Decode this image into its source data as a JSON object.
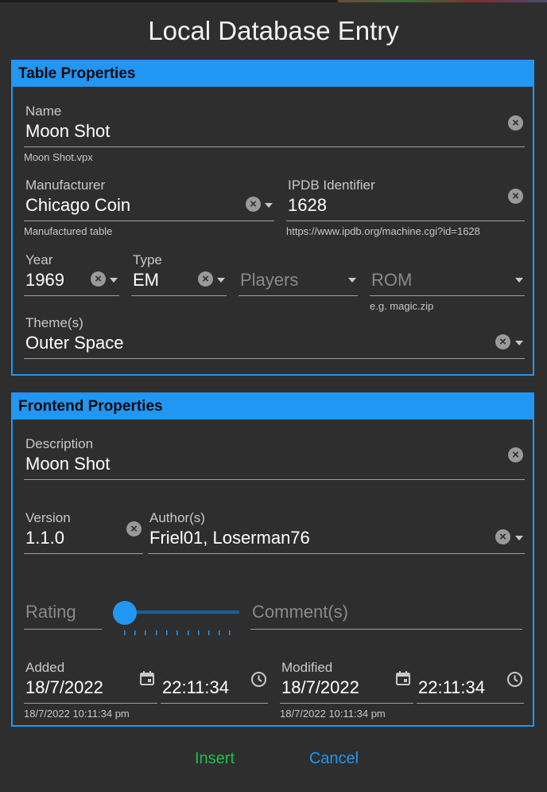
{
  "dialog": {
    "title": "Local Database Entry"
  },
  "table_properties": {
    "header": "Table Properties",
    "name": {
      "label": "Name",
      "value": "Moon Shot",
      "helper": "Moon Shot.vpx"
    },
    "manufacturer": {
      "label": "Manufacturer",
      "value": "Chicago Coin",
      "helper": "Manufactured table"
    },
    "ipdb": {
      "label": "IPDB Identifier",
      "value": "1628",
      "helper": "https://www.ipdb.org/machine.cgi?id=1628"
    },
    "year": {
      "label": "Year",
      "value": "1969"
    },
    "type": {
      "label": "Type",
      "value": "EM"
    },
    "players": {
      "placeholder": "Players"
    },
    "rom": {
      "placeholder": "ROM",
      "helper": "e.g. magic.zip"
    },
    "themes": {
      "label": "Theme(s)",
      "value": "Outer Space"
    }
  },
  "frontend_properties": {
    "header": "Frontend Properties",
    "description": {
      "label": "Description",
      "value": "Moon Shot"
    },
    "version": {
      "label": "Version",
      "value": "1.1.0"
    },
    "authors": {
      "label": "Author(s)",
      "value": "Friel01, Loserman76"
    },
    "rating": {
      "placeholder": "Rating",
      "level": 0
    },
    "comments": {
      "placeholder": "Comment(s)"
    },
    "added": {
      "label": "Added",
      "date": "18/7/2022",
      "time": "22:11:34",
      "helper": "18/7/2022 10:11:34 pm"
    },
    "modified": {
      "label": "Modified",
      "date": "18/7/2022",
      "time": "22:11:34",
      "helper": "18/7/2022 10:11:34 pm"
    }
  },
  "actions": {
    "insert_label": "Insert",
    "cancel_label": "Cancel"
  },
  "colors": {
    "accent": "#2196f3",
    "insert": "#1fbf4f",
    "cancel": "#2196f3",
    "background": "#2e2e2e"
  },
  "icons": {
    "clear": "clear-icon",
    "dropdown": "chevron-down-icon",
    "calendar": "calendar-icon",
    "clock": "clock-icon"
  }
}
